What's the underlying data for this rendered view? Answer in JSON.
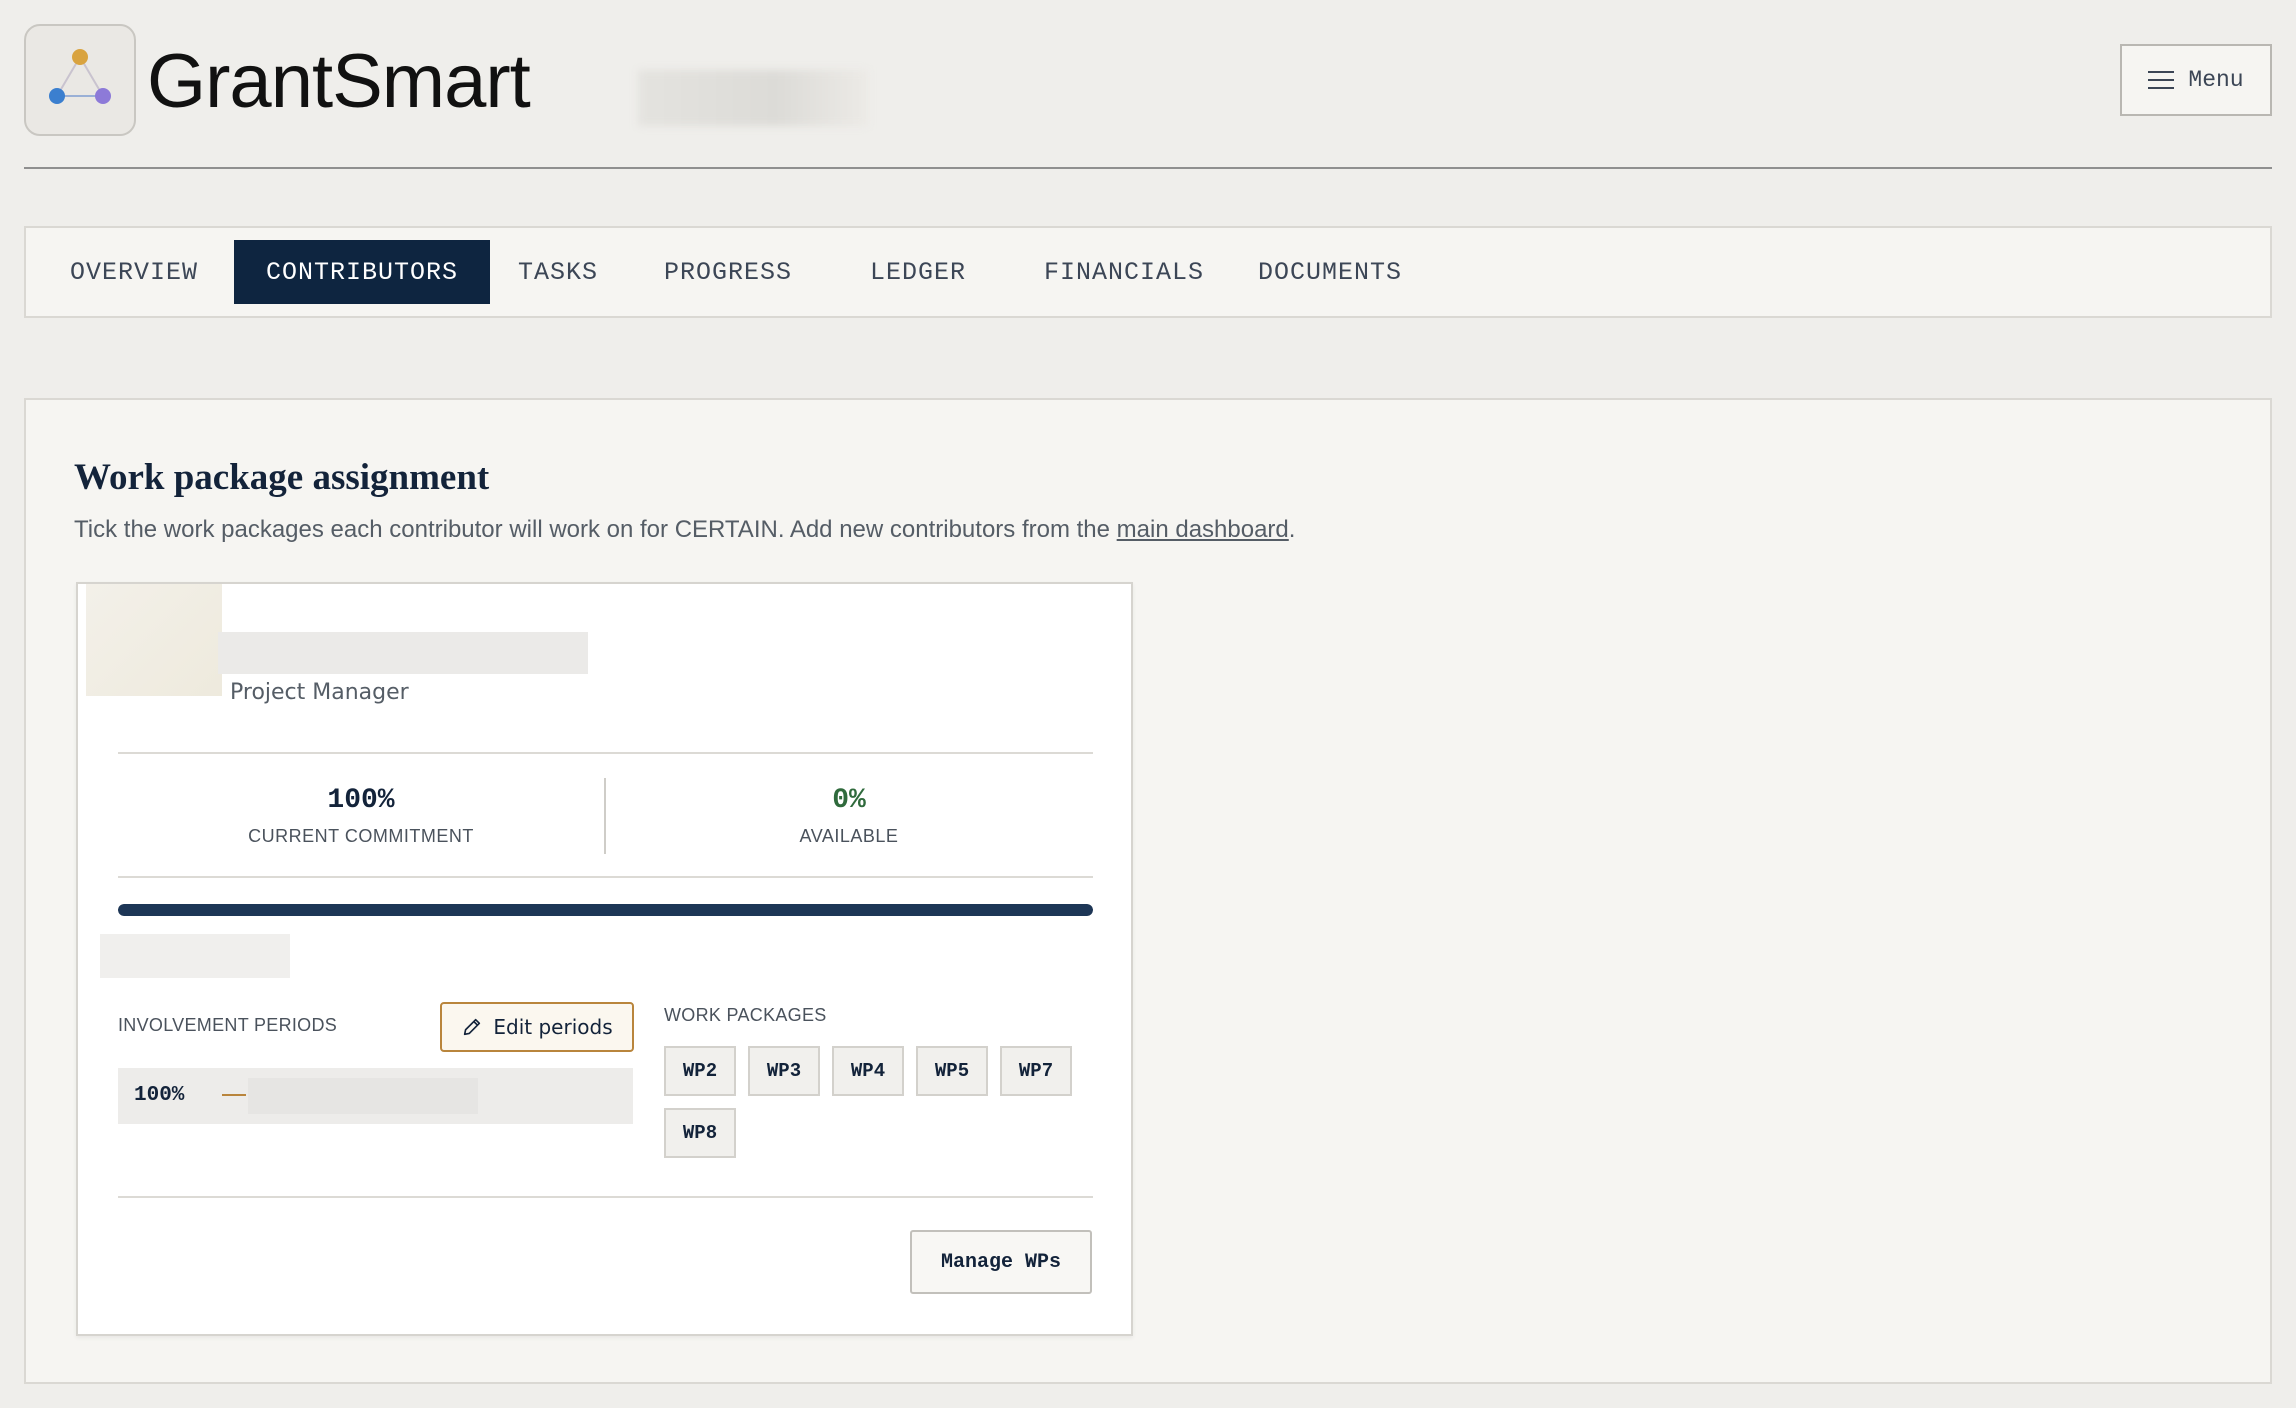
{
  "app": {
    "brand": "GrantSmart"
  },
  "header": {
    "menu_label": "Menu"
  },
  "tabs": [
    {
      "label": "OVERVIEW",
      "active": false
    },
    {
      "label": "CONTRIBUTORS",
      "active": true
    },
    {
      "label": "TASKS",
      "active": false
    },
    {
      "label": "PROGRESS",
      "active": false
    },
    {
      "label": "LEDGER",
      "active": false
    },
    {
      "label": "FINANCIALS",
      "active": false
    },
    {
      "label": "DOCUMENTS",
      "active": false
    }
  ],
  "panel": {
    "title": "Work package assignment",
    "desc_before": "Tick the work packages each contributor will work on for CERTAIN. Add new contributors from the ",
    "desc_link": "main dashboard",
    "desc_after": "."
  },
  "contributor": {
    "role": "Project Manager",
    "current_commitment_value": "100%",
    "current_commitment_label": "CURRENT COMMITMENT",
    "available_value": "0%",
    "available_label": "AVAILABLE",
    "commitment_fraction": 1.0,
    "involvement_label": "INVOLVEMENT PERIODS",
    "edit_periods_label": "Edit periods",
    "period_pct": "100%",
    "work_packages_label": "WORK PACKAGES",
    "work_packages": [
      "WP2",
      "WP3",
      "WP4",
      "WP5",
      "WP7",
      "WP8"
    ],
    "manage_label": "Manage WPs"
  },
  "colors": {
    "accent_dark": "#0e2540",
    "available_green": "#2f6a3c",
    "edit_border": "#b9853c"
  }
}
